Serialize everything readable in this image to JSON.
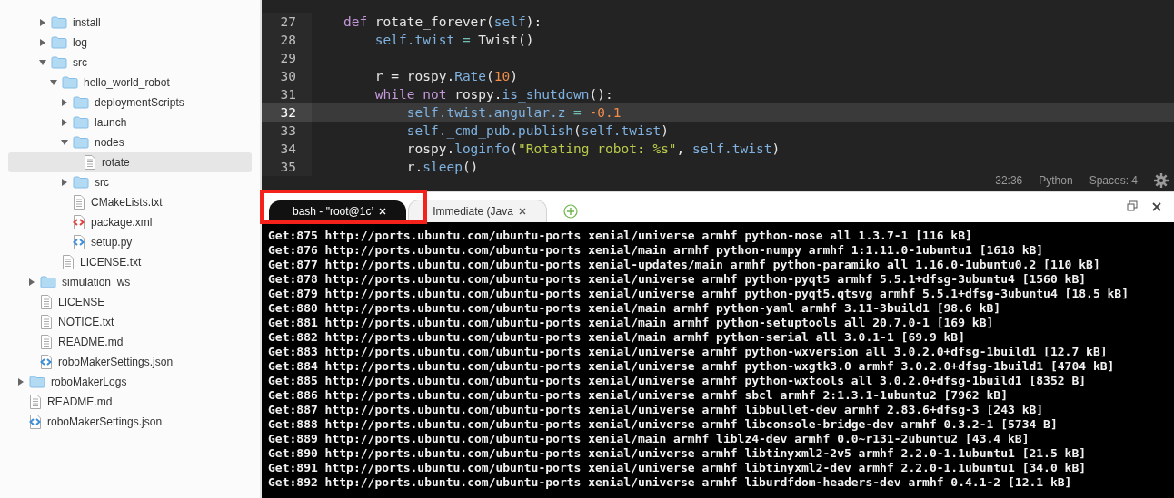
{
  "tree": [
    {
      "children": [
        {
          "children": [
            {
              "name": "install",
              "kind": "folder",
              "expanded": false,
              "selected": false
            },
            {
              "name": "log",
              "kind": "folder",
              "expanded": false,
              "selected": false
            },
            {
              "name": "src",
              "kind": "folder",
              "expanded": true,
              "selected": false,
              "children": [
                {
                  "name": "hello_world_robot",
                  "kind": "folder",
                  "expanded": true,
                  "selected": false,
                  "children": [
                    {
                      "name": "deploymentScripts",
                      "kind": "folder",
                      "expanded": false,
                      "selected": false
                    },
                    {
                      "name": "launch",
                      "kind": "folder",
                      "expanded": false,
                      "selected": false
                    },
                    {
                      "name": "nodes",
                      "kind": "folder",
                      "expanded": true,
                      "selected": false,
                      "children": [
                        {
                          "name": "rotate",
                          "kind": "file",
                          "selected": true
                        }
                      ]
                    },
                    {
                      "name": "src",
                      "kind": "folder",
                      "expanded": false,
                      "selected": false
                    },
                    {
                      "name": "CMakeLists.txt",
                      "kind": "file",
                      "selected": false
                    },
                    {
                      "name": "package.xml",
                      "kind": "xml",
                      "selected": false
                    },
                    {
                      "name": "setup.py",
                      "kind": "code",
                      "selected": false
                    }
                  ]
                },
                {
                  "name": "LICENSE.txt",
                  "kind": "file",
                  "selected": false
                }
              ]
            }
          ]
        },
        {
          "name": "simulation_ws",
          "kind": "folder",
          "expanded": false,
          "selected": false
        },
        {
          "name": "LICENSE",
          "kind": "file",
          "selected": false
        },
        {
          "name": "NOTICE.txt",
          "kind": "file",
          "selected": false
        },
        {
          "name": "README.md",
          "kind": "file",
          "selected": false
        },
        {
          "name": "roboMakerSettings.json",
          "kind": "code",
          "selected": false
        }
      ]
    },
    {
      "name": "roboMakerLogs",
      "kind": "folder",
      "expanded": false,
      "selected": false
    },
    {
      "name": "README.md",
      "kind": "file",
      "selected": false
    },
    {
      "name": "roboMakerSettings.json",
      "kind": "code",
      "selected": false
    }
  ],
  "editor": {
    "lines": [
      {
        "number": "27",
        "current": false,
        "tokens": [
          {
            "text": "    def",
            "color": "#c397d8"
          },
          {
            "text": " rotate_forever(",
            "color": "#e6e6e6"
          },
          {
            "text": "self",
            "color": "#7fb2e0"
          },
          {
            "text": "):",
            "color": "#e6e6e6"
          }
        ]
      },
      {
        "number": "28",
        "current": false,
        "tokens": [
          {
            "text": "        self.twist",
            "color": "#7fb2e0"
          },
          {
            "text": " = ",
            "color": "#70c0b1"
          },
          {
            "text": "Twist()",
            "color": "#e6e6e6"
          }
        ]
      },
      {
        "number": "29",
        "current": false
      },
      {
        "number": "30",
        "current": false,
        "tokens": [
          {
            "text": "        r = rospy.",
            "color": "#e6e6e6"
          },
          {
            "text": "Rate",
            "color": "#7fb2e0"
          },
          {
            "text": "(",
            "color": "#e6e6e6"
          },
          {
            "text": "10",
            "color": "#f08d49"
          },
          {
            "text": ")",
            "color": "#e6e6e6"
          }
        ]
      },
      {
        "number": "31",
        "current": false,
        "tokens": [
          {
            "text": "        while not",
            "color": "#c397d8"
          },
          {
            "text": " rospy.",
            "color": "#e6e6e6"
          },
          {
            "text": "is_shutdown",
            "color": "#7fb2e0"
          },
          {
            "text": "():",
            "color": "#e6e6e6"
          }
        ]
      },
      {
        "number": "32",
        "current": true,
        "tokens": [
          {
            "text": "            self.twist.angular.z",
            "color": "#7fb2e0"
          },
          {
            "text": " = ",
            "color": "#70c0b1"
          },
          {
            "text": "-0.1",
            "color": "#f08d49"
          }
        ]
      },
      {
        "number": "33",
        "current": false,
        "tokens": [
          {
            "text": "            self._cmd_pub.publish",
            "color": "#7fb2e0"
          },
          {
            "text": "(",
            "color": "#e6e6e6"
          },
          {
            "text": "self.twist",
            "color": "#7fb2e0"
          },
          {
            "text": ")",
            "color": "#e6e6e6"
          }
        ]
      },
      {
        "number": "34",
        "current": false,
        "tokens": [
          {
            "text": "            rospy.",
            "color": "#e6e6e6"
          },
          {
            "text": "loginfo",
            "color": "#7fb2e0"
          },
          {
            "text": "(",
            "color": "#e6e6e6"
          },
          {
            "text": "\"Rotating robot: %s\"",
            "color": "#b9ca4a"
          },
          {
            "text": ", ",
            "color": "#e6e6e6"
          },
          {
            "text": "self.twist",
            "color": "#7fb2e0"
          },
          {
            "text": ")",
            "color": "#e6e6e6"
          }
        ]
      },
      {
        "number": "35",
        "current": false,
        "tokens": [
          {
            "text": "            r.",
            "color": "#e6e6e6"
          },
          {
            "text": "sleep",
            "color": "#7fb2e0"
          },
          {
            "text": "()",
            "color": "#e6e6e6"
          }
        ]
      }
    ],
    "status": {
      "cursor": "32:36",
      "language": "Python",
      "indent": "Spaces: 4"
    }
  },
  "terminal": {
    "tabs": [
      {
        "label": "bash - \"root@1c’",
        "selected": true
      },
      {
        "label": "Immediate (Java",
        "selected": false
      }
    ],
    "lines": [
      "Get:875 http://ports.ubuntu.com/ubuntu-ports xenial/universe armhf python-nose all 1.3.7-1 [116 kB]",
      "Get:876 http://ports.ubuntu.com/ubuntu-ports xenial/main armhf python-numpy armhf 1:1.11.0-1ubuntu1 [1618 kB]",
      "Get:877 http://ports.ubuntu.com/ubuntu-ports xenial-updates/main armhf python-paramiko all 1.16.0-1ubuntu0.2 [110 kB]",
      "Get:878 http://ports.ubuntu.com/ubuntu-ports xenial/universe armhf python-pyqt5 armhf 5.5.1+dfsg-3ubuntu4 [1560 kB]",
      "Get:879 http://ports.ubuntu.com/ubuntu-ports xenial/universe armhf python-pyqt5.qtsvg armhf 5.5.1+dfsg-3ubuntu4 [18.5 kB]",
      "Get:880 http://ports.ubuntu.com/ubuntu-ports xenial/main armhf python-yaml armhf 3.11-3build1 [98.6 kB]",
      "Get:881 http://ports.ubuntu.com/ubuntu-ports xenial/main armhf python-setuptools all 20.7.0-1 [169 kB]",
      "Get:882 http://ports.ubuntu.com/ubuntu-ports xenial/main armhf python-serial all 3.0.1-1 [69.9 kB]",
      "Get:883 http://ports.ubuntu.com/ubuntu-ports xenial/universe armhf python-wxversion all 3.0.2.0+dfsg-1build1 [12.7 kB]",
      "Get:884 http://ports.ubuntu.com/ubuntu-ports xenial/universe armhf python-wxgtk3.0 armhf 3.0.2.0+dfsg-1build1 [4704 kB]",
      "Get:885 http://ports.ubuntu.com/ubuntu-ports xenial/universe armhf python-wxtools all 3.0.2.0+dfsg-1build1 [8352 B]",
      "Get:886 http://ports.ubuntu.com/ubuntu-ports xenial/universe armhf sbcl armhf 2:1.3.1-1ubuntu2 [7962 kB]",
      "Get:887 http://ports.ubuntu.com/ubuntu-ports xenial/universe armhf libbullet-dev armhf 2.83.6+dfsg-3 [243 kB]",
      "Get:888 http://ports.ubuntu.com/ubuntu-ports xenial/universe armhf libconsole-bridge-dev armhf 0.3.2-1 [5734 B]",
      "Get:889 http://ports.ubuntu.com/ubuntu-ports xenial/main armhf liblz4-dev armhf 0.0~r131-2ubuntu2 [43.4 kB]",
      "Get:890 http://ports.ubuntu.com/ubuntu-ports xenial/universe armhf libtinyxml2-2v5 armhf 2.2.0-1.1ubuntu1 [21.5 kB]",
      "Get:891 http://ports.ubuntu.com/ubuntu-ports xenial/universe armhf libtinyxml2-dev armhf 2.2.0-1.1ubuntu1 [34.0 kB]",
      "Get:892 http://ports.ubuntu.com/ubuntu-ports xenial/universe armhf liburdfdom-headers-dev armhf 0.4.1-2 [12.1 kB]"
    ]
  }
}
